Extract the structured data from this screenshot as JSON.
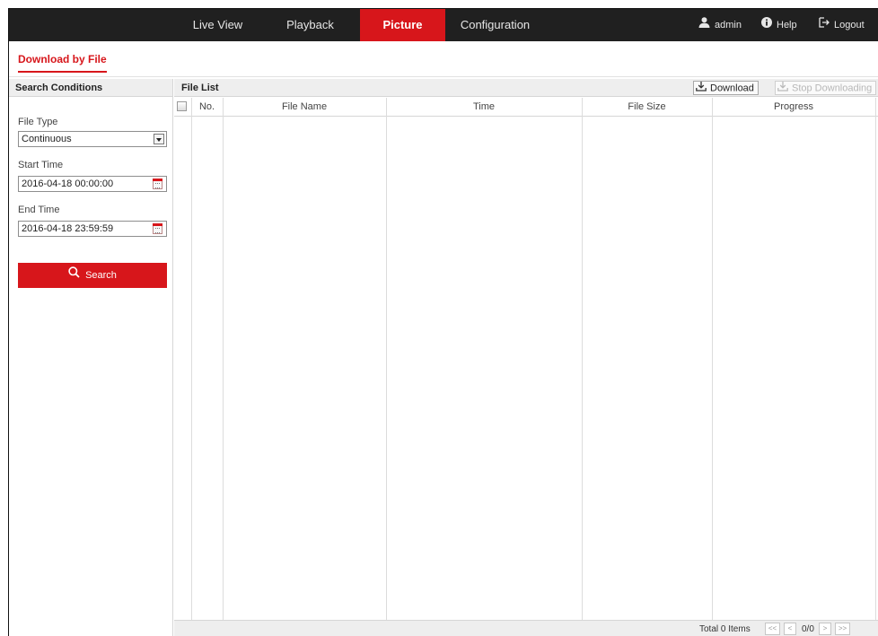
{
  "nav": {
    "tabs": [
      {
        "label": "Live View"
      },
      {
        "label": "Playback"
      },
      {
        "label": "Picture"
      },
      {
        "label": "Configuration"
      }
    ],
    "active_tab": "Picture",
    "user": "admin",
    "help": "Help",
    "logout": "Logout"
  },
  "subnav": {
    "active": "Download by File"
  },
  "search": {
    "header": "Search Conditions",
    "file_type_label": "File Type",
    "file_type_value": "Continuous",
    "start_label": "Start Time",
    "start_value": "2016-04-18 00:00:00",
    "end_label": "End Time",
    "end_value": "2016-04-18 23:59:59",
    "button": "Search"
  },
  "file_list": {
    "title": "File List",
    "download_button": "Download",
    "stop_button": "Stop Downloading",
    "columns": [
      "No.",
      "File Name",
      "Time",
      "File Size",
      "Progress"
    ],
    "rows": [],
    "footer": {
      "total": "Total 0 Items",
      "first": "<<",
      "prev": "<",
      "page": "0/0",
      "next": ">",
      "last": ">>"
    }
  },
  "colors": {
    "accent": "#d7161b",
    "topbar": "#202020",
    "panel_header": "#eeeeee"
  }
}
